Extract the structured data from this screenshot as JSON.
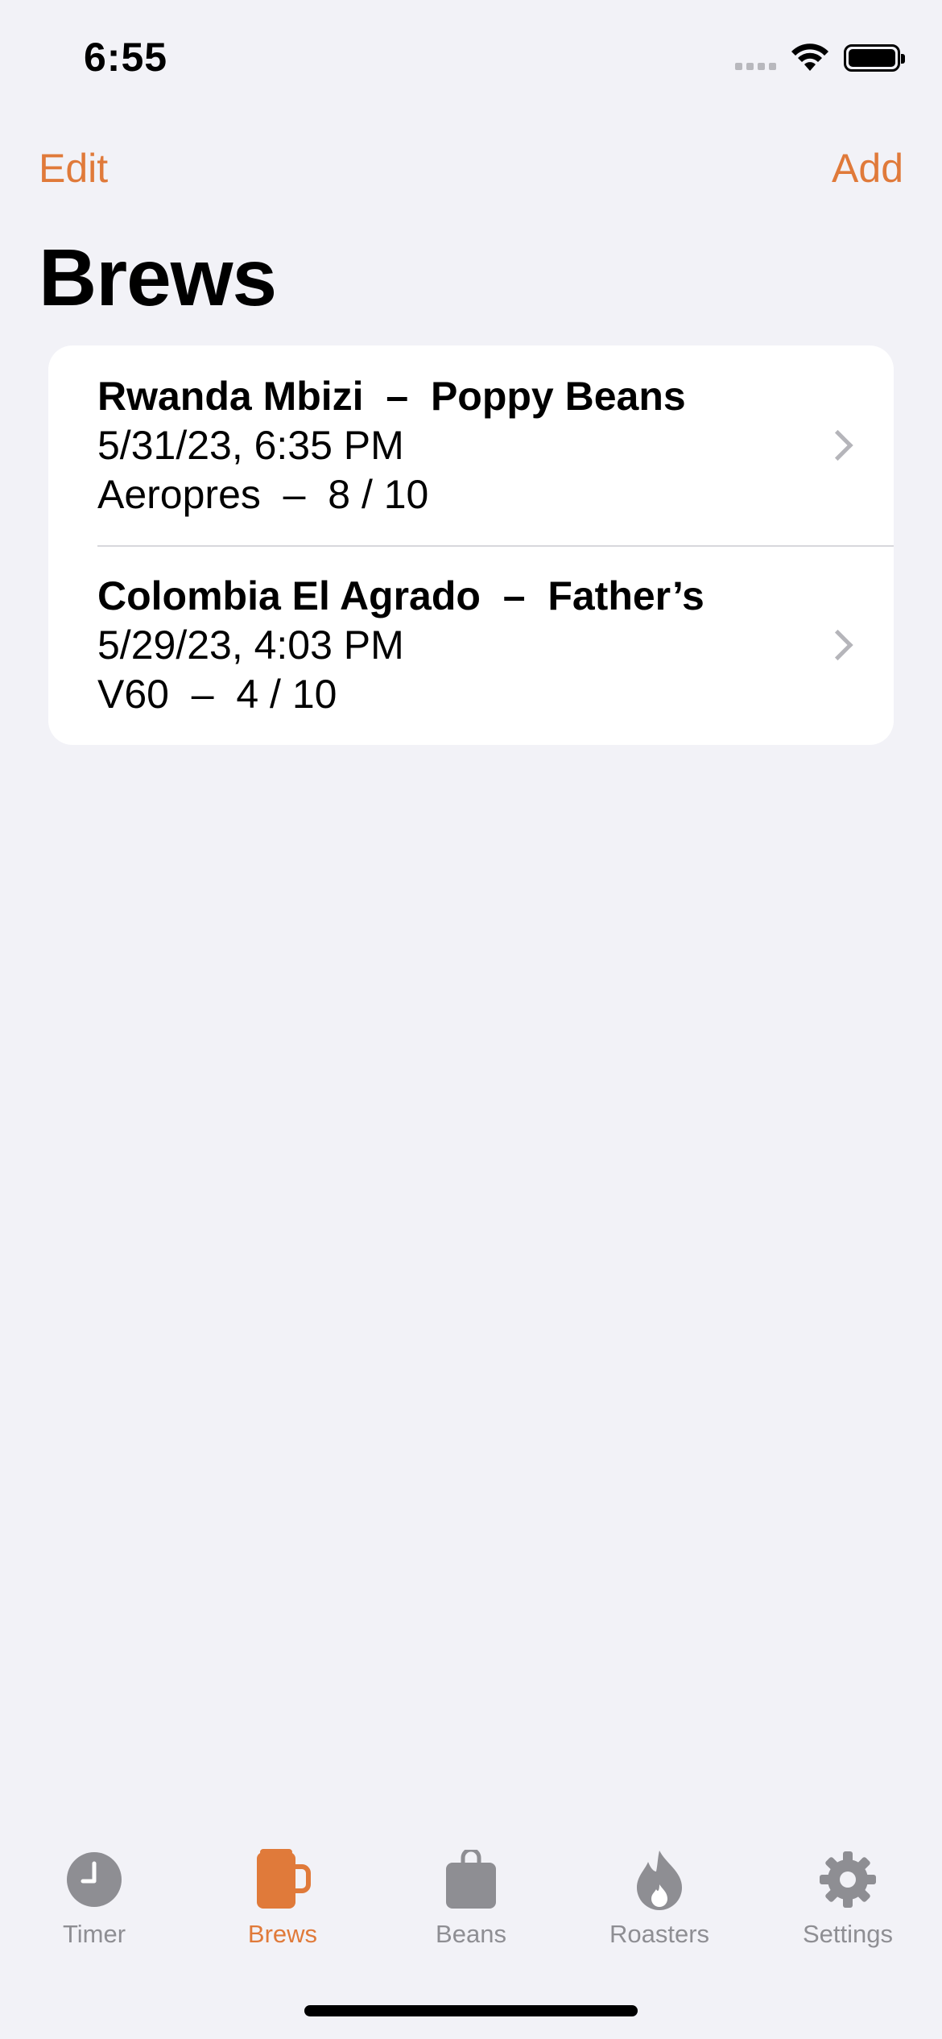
{
  "status": {
    "time": "6:55"
  },
  "nav": {
    "edit_label": "Edit",
    "add_label": "Add",
    "title": "Brews"
  },
  "brews": [
    {
      "title": "Rwanda Mbizi  –  Poppy Beans",
      "date": "5/31/23, 6:35 PM",
      "detail": "Aeropres  –  8 / 10"
    },
    {
      "title": "Colombia El Agrado  –  Father’s",
      "date": "5/29/23, 4:03 PM",
      "detail": "V60  –  4 / 10"
    }
  ],
  "tabs": [
    {
      "label": "Timer",
      "icon": "clock-icon"
    },
    {
      "label": "Brews",
      "icon": "mug-icon",
      "active": true
    },
    {
      "label": "Beans",
      "icon": "bag-icon"
    },
    {
      "label": "Roasters",
      "icon": "flame-icon"
    },
    {
      "label": "Settings",
      "icon": "gear-icon"
    }
  ],
  "colors": {
    "accent": "#e07a3a",
    "inactive": "#8e8e93",
    "background": "#f2f2f7"
  }
}
